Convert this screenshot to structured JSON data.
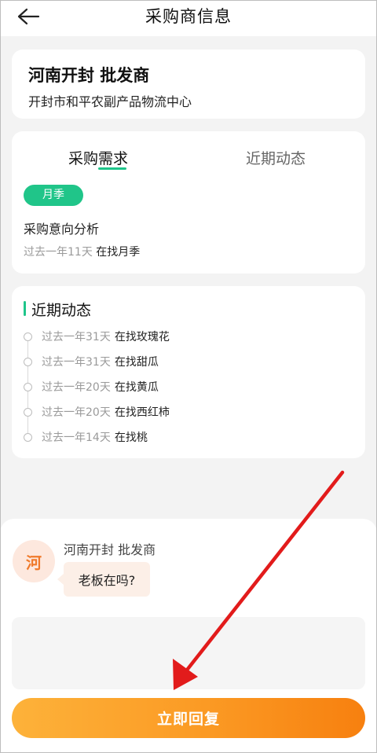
{
  "header": {
    "title": "采购商信息",
    "back_icon": "arrow-left-icon"
  },
  "buyer": {
    "name": "河南开封 批发商",
    "location": "开封市和平农副产品物流中心"
  },
  "demand": {
    "tabs": [
      {
        "label": "采购需求",
        "active": true
      },
      {
        "label": "近期动态",
        "active": false
      }
    ],
    "chip": "月季",
    "analysis_title": "采购意向分析",
    "analysis_time": "过去一年11天",
    "analysis_desc": "在找月季"
  },
  "recent": {
    "title": "近期动态",
    "items": [
      {
        "time": "过去一年31天",
        "desc": "在找玫瑰花"
      },
      {
        "time": "过去一年31天",
        "desc": "在找甜瓜"
      },
      {
        "time": "过去一年20天",
        "desc": "在找黄瓜"
      },
      {
        "time": "过去一年20天",
        "desc": "在找西红柿"
      },
      {
        "time": "过去一年14天",
        "desc": "在找桃"
      }
    ]
  },
  "chat": {
    "avatar_text": "河",
    "sender": "河南开封 批发商",
    "message": "老板在吗?",
    "input_placeholder": "",
    "reply_button": "立即回复"
  },
  "colors": {
    "accent_green": "#1fc58a",
    "button_orange_start": "#fdb23a",
    "button_orange_end": "#f7800f",
    "annotation_red": "#e21b1b"
  }
}
